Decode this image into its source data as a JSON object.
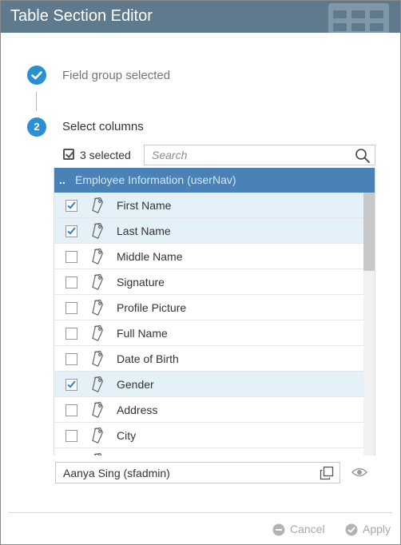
{
  "dialog": {
    "title": "Table Section Editor"
  },
  "steps": [
    {
      "number": "1",
      "label": "Field group selected",
      "status": "complete"
    },
    {
      "number": "2",
      "label": "Select columns",
      "status": "active"
    }
  ],
  "selection": {
    "count_label": "3 selected"
  },
  "search": {
    "placeholder": "Search",
    "value": ""
  },
  "list": {
    "header_dots": "..",
    "header": "Employee Information (userNav)",
    "rows": [
      {
        "label": "First Name",
        "checked": true
      },
      {
        "label": "Last Name",
        "checked": true
      },
      {
        "label": "Middle Name",
        "checked": false
      },
      {
        "label": "Signature",
        "checked": false
      },
      {
        "label": "Profile Picture",
        "checked": false
      },
      {
        "label": "Full Name",
        "checked": false
      },
      {
        "label": "Date of Birth",
        "checked": false
      },
      {
        "label": "Gender",
        "checked": true
      },
      {
        "label": "Address",
        "checked": false
      },
      {
        "label": "City",
        "checked": false
      },
      {
        "label": "",
        "checked": false
      }
    ]
  },
  "user_field": {
    "value": "Aanya Sing (sfadmin)"
  },
  "footer": {
    "cancel_label": "Cancel",
    "apply_label": "Apply"
  },
  "colors": {
    "header_bg": "#5f7a8c",
    "step_accent": "#2b8fd6",
    "list_header_bg": "#4a81b6",
    "checked_row_bg": "#e5f1f9"
  }
}
